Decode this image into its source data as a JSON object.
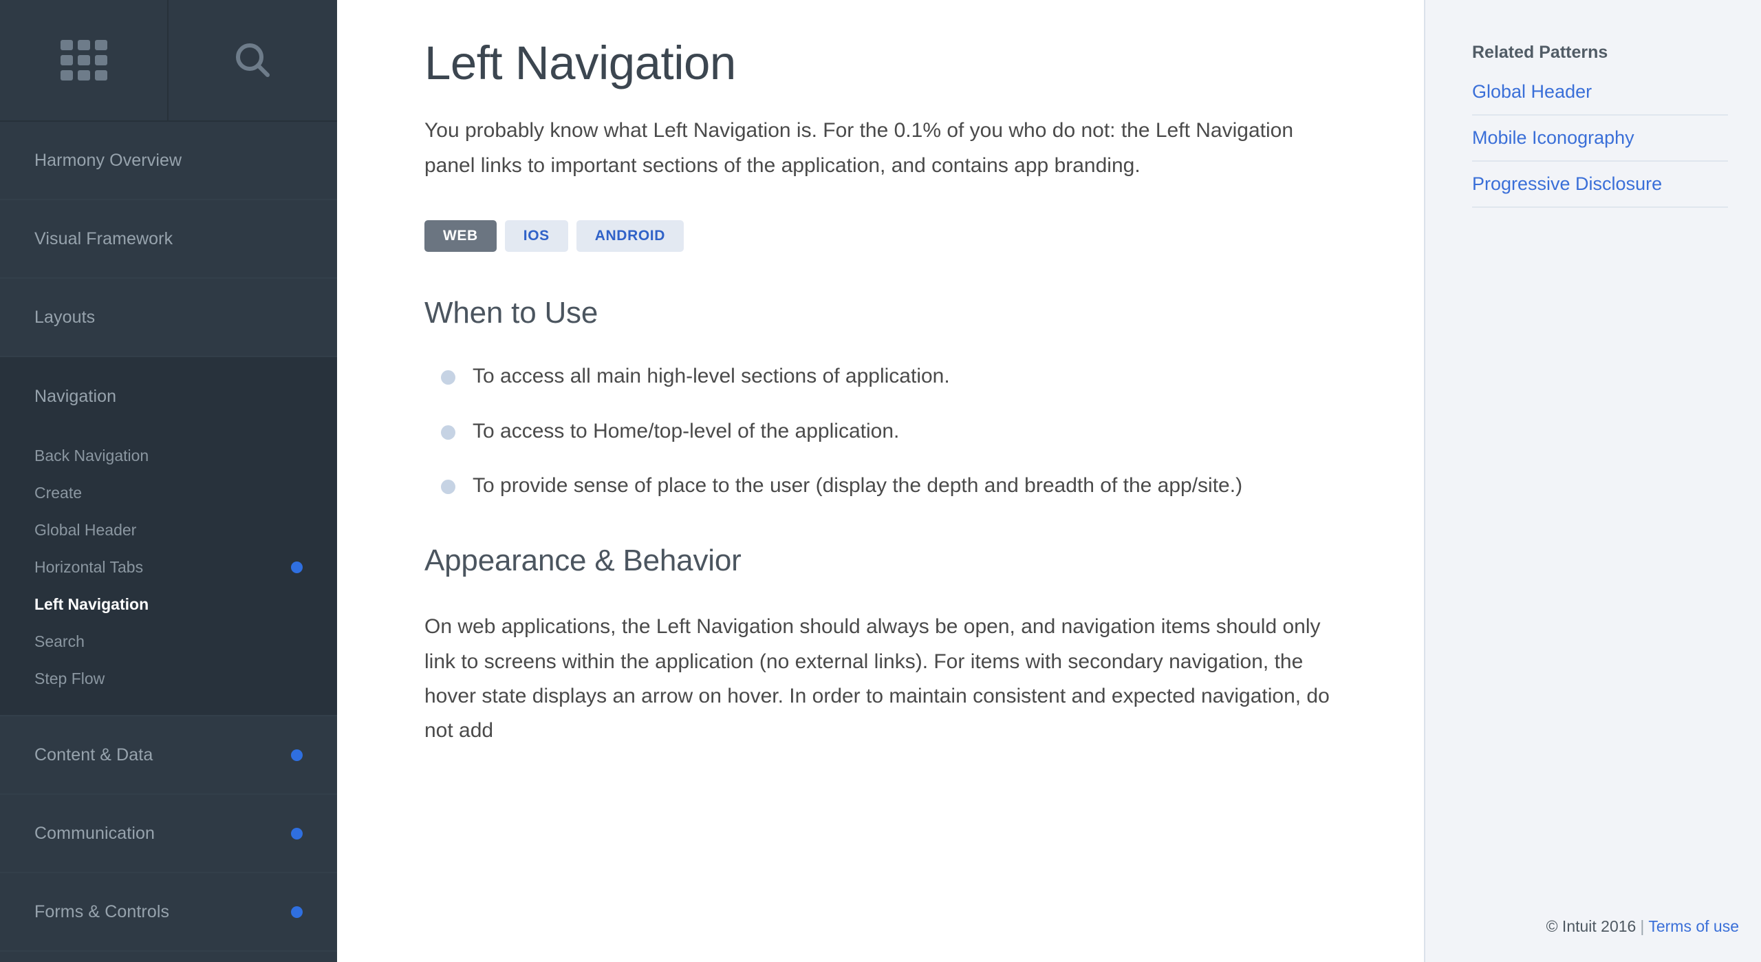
{
  "sidebar": {
    "header": {
      "grid_icon": "grid-apps-icon",
      "search_icon": "search-icon"
    },
    "top_items": [
      {
        "label": "Harmony Overview",
        "has_dot": false,
        "expanded": false
      },
      {
        "label": "Visual Framework",
        "has_dot": false,
        "expanded": false
      },
      {
        "label": "Layouts",
        "has_dot": false,
        "expanded": false
      },
      {
        "label": "Navigation",
        "has_dot": false,
        "expanded": true
      }
    ],
    "sub_items": [
      {
        "label": "Back Navigation",
        "active": false,
        "has_dot": false
      },
      {
        "label": "Create",
        "active": false,
        "has_dot": false
      },
      {
        "label": "Global Header",
        "active": false,
        "has_dot": false
      },
      {
        "label": "Horizontal Tabs",
        "active": false,
        "has_dot": true
      },
      {
        "label": "Left Navigation",
        "active": true,
        "has_dot": false
      },
      {
        "label": "Search",
        "active": false,
        "has_dot": false
      },
      {
        "label": "Step Flow",
        "active": false,
        "has_dot": false
      }
    ],
    "bottom_items": [
      {
        "label": "Content & Data",
        "has_dot": true
      },
      {
        "label": "Communication",
        "has_dot": true
      },
      {
        "label": "Forms & Controls",
        "has_dot": true
      }
    ],
    "dot_color": "#2f6fe0"
  },
  "main": {
    "title": "Left Navigation",
    "intro": "You probably know what Left Navigation is. For the 0.1% of you who do not: the Left Navigation panel links to important sections of the application, and contains app branding.",
    "platform_tabs": [
      {
        "label": "WEB",
        "active": true
      },
      {
        "label": "IOS",
        "active": false
      },
      {
        "label": "ANDROID",
        "active": false
      }
    ],
    "sections": [
      {
        "heading": "When to Use",
        "bullets": [
          "To access all main high-level sections of application.",
          "To access to Home/top-level of the application.",
          "To provide sense of place to the user (display the depth and breadth of the app/site.)"
        ]
      },
      {
        "heading": "Appearance & Behavior",
        "paragraph": "On web applications, the Left Navigation should always be open, and navigation items should only link to screens within the application (no external links). For items with secondary navigation, the hover state displays an arrow on hover. In order to maintain consistent and expected navigation, do not add"
      }
    ]
  },
  "right_panel": {
    "title": "Related Patterns",
    "links": [
      "Global Header",
      "Mobile Iconography",
      "Progressive Disclosure"
    ]
  },
  "footer": {
    "copyright": "© Intuit 2016",
    "separator": "|",
    "terms_label": "Terms of use"
  }
}
